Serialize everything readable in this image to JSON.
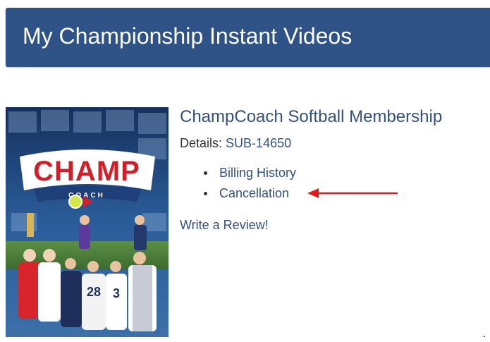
{
  "header": {
    "title": "My Championship Instant Videos"
  },
  "product": {
    "title": "ChampCoach Softball Membership",
    "details_label": "Details:",
    "details_value": "SUB-14650",
    "image": {
      "logo_word": "CHAMP",
      "logo_subword": "COACH"
    },
    "links": [
      {
        "label": "Billing History"
      },
      {
        "label": "Cancellation"
      }
    ],
    "review_label": "Write a Review!"
  },
  "colors": {
    "header_bg": "#2f5387",
    "link": "#34507d",
    "arrow": "#e3191b"
  }
}
